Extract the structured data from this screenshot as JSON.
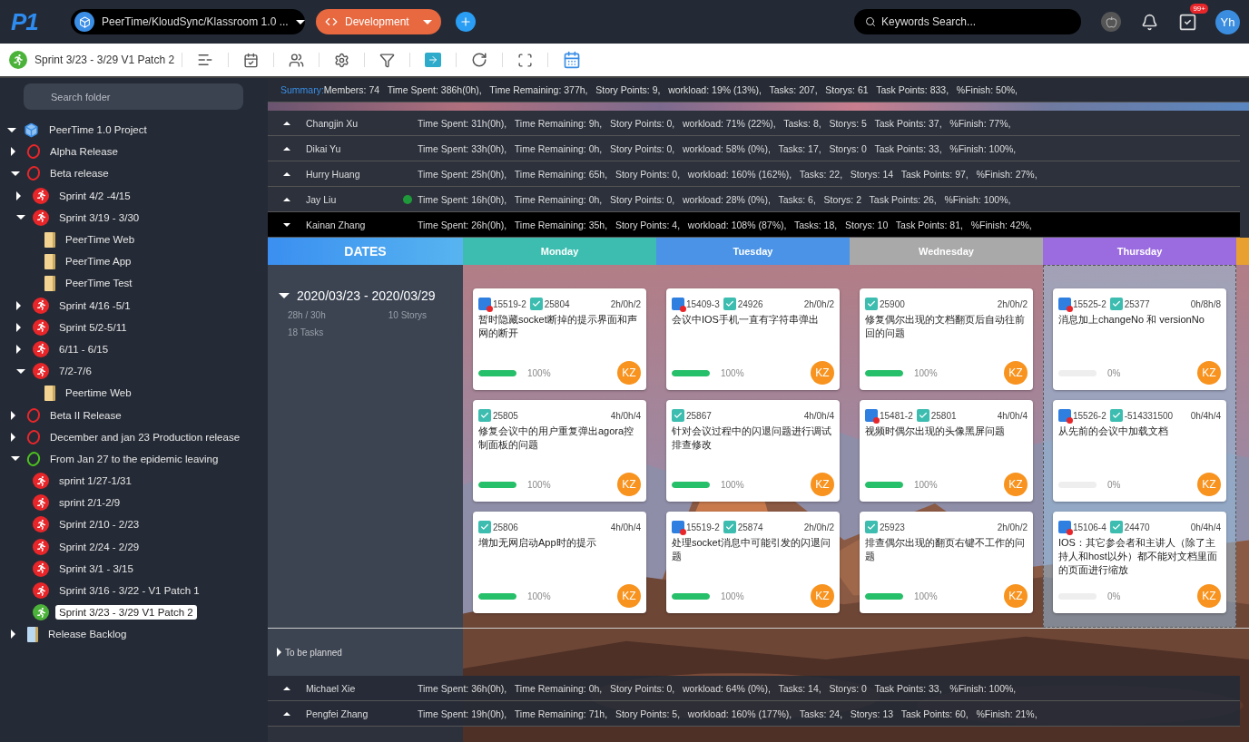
{
  "top_bar": {
    "logo": "P1",
    "project": "PeerTime/KloudSync/Klassroom 1.0 ...",
    "environment": "Development",
    "search": {
      "placeholder": "Keywords Search..."
    },
    "notification_badge": "99+",
    "avatar": "Yh"
  },
  "toolbar": {
    "sprint": "Sprint 3/23 - 3/29 V1 Patch 2"
  },
  "sidebar": {
    "search": {
      "placeholder": "Search folder"
    },
    "tree": [
      {
        "label": "PeerTime 1.0 Project",
        "kind": "project",
        "expanded": true,
        "selected": false,
        "children": [
          {
            "label": "Alpha Release",
            "kind": "release",
            "color": "#e8262a",
            "expanded": false,
            "selected": false
          },
          {
            "label": "Beta release",
            "kind": "release",
            "color": "#e8262a",
            "expanded": true,
            "selected": false,
            "children": [
              {
                "label": "Sprint 4/2 -4/15",
                "kind": "sprint",
                "color": "#e8262a",
                "expanded": false,
                "selected": false
              },
              {
                "label": "Sprint 3/19 - 3/30",
                "kind": "sprint",
                "color": "#e8262a",
                "expanded": true,
                "selected": false,
                "children": [
                  {
                    "label": "PeerTime Web",
                    "kind": "folder",
                    "selected": false
                  },
                  {
                    "label": "PeerTime App",
                    "kind": "folder",
                    "selected": false
                  },
                  {
                    "label": "PeerTime Test",
                    "kind": "folder",
                    "selected": false
                  }
                ]
              },
              {
                "label": "Sprint 4/16 -5/1",
                "kind": "sprint",
                "color": "#e8262a",
                "expanded": false,
                "selected": false
              },
              {
                "label": "Sprint 5/2-5/11",
                "kind": "sprint",
                "color": "#e8262a",
                "expanded": false,
                "selected": false
              },
              {
                "label": "6/11 - 6/15",
                "kind": "sprint",
                "color": "#e8262a",
                "expanded": false,
                "selected": false
              },
              {
                "label": "7/2-7/6",
                "kind": "sprint",
                "color": "#e8262a",
                "expanded": true,
                "selected": false,
                "children": [
                  {
                    "label": "Peertime Web",
                    "kind": "folder",
                    "selected": false
                  }
                ]
              }
            ]
          },
          {
            "label": "Beta II Release",
            "kind": "release",
            "color": "#e8262a",
            "expanded": false,
            "selected": false
          },
          {
            "label": "December and jan 23 Production release",
            "kind": "release",
            "color": "#e8262a",
            "expanded": false,
            "selected": false
          },
          {
            "label": "From Jan 27 to the epidemic leaving",
            "kind": "release",
            "color": "#4cc21e",
            "expanded": true,
            "selected": false,
            "children": [
              {
                "label": "sprint 1/27-1/31",
                "kind": "sprint",
                "color": "#e8262a",
                "selected": false
              },
              {
                "label": "sprint 2/1-2/9",
                "kind": "sprint",
                "color": "#e8262a",
                "selected": false
              },
              {
                "label": "Sprint 2/10 - 2/23",
                "kind": "sprint",
                "color": "#e8262a",
                "selected": false
              },
              {
                "label": "Sprint 2/24 - 2/29",
                "kind": "sprint",
                "color": "#e8262a",
                "selected": false
              },
              {
                "label": "Sprint 3/1 - 3/15",
                "kind": "sprint",
                "color": "#e8262a",
                "selected": false
              },
              {
                "label": "Sprint 3/16 - 3/22 - V1 Patch 1",
                "kind": "sprint",
                "color": "#e8262a",
                "selected": false
              },
              {
                "label": "Sprint 3/23 - 3/29 V1 Patch 2",
                "kind": "sprint",
                "color": "#4cb33a",
                "selected": true
              }
            ]
          },
          {
            "label": "Release Backlog",
            "kind": "backlog",
            "expanded": false,
            "selected": false
          }
        ]
      }
    ]
  },
  "summary": {
    "label": "Summary:",
    "text": "Members: 74   Time Spent: 386h(0h),   Time Remaining: 377h,   Story Points: 9,   workload: 19% (13%),   Tasks: 207,   Storys: 61   Task Points: 833,   %Finish: 50%,"
  },
  "members": [
    {
      "name": "Changjin Xu",
      "online": false,
      "expanded": false,
      "stats": "Time Spent: 31h(0h),   Time Remaining: 9h,   Story Points: 0,   workload: 71% (22%),   Tasks: 8,   Storys: 5   Task Points: 37,   %Finish: 77%,"
    },
    {
      "name": "Dikai Yu",
      "online": false,
      "expanded": false,
      "stats": "Time Spent: 33h(0h),   Time Remaining: 0h,   Story Points: 0,   workload: 58% (0%),   Tasks: 17,   Storys: 0   Task Points: 33,   %Finish: 100%,"
    },
    {
      "name": "Hurry Huang",
      "online": false,
      "expanded": false,
      "stats": "Time Spent: 25h(0h),   Time Remaining: 65h,   Story Points: 0,   workload: 160% (162%),   Tasks: 22,   Storys: 14   Task Points: 97,   %Finish: 27%,"
    },
    {
      "name": "Jay Liu",
      "online": true,
      "expanded": false,
      "stats": "Time Spent: 16h(0h),   Time Remaining: 0h,   Story Points: 0,   workload: 28% (0%),   Tasks: 6,   Storys: 2   Task Points: 26,   %Finish: 100%,"
    },
    {
      "name": "Kainan Zhang",
      "online": false,
      "expanded": true,
      "stats": "Time Spent: 26h(0h),   Time Remaining: 35h,   Story Points: 4,   workload: 108% (87%),   Tasks: 18,   Storys: 10   Task Points: 81,   %Finish: 42%,"
    }
  ],
  "calendar": {
    "dates_header": "DATES",
    "range": {
      "label": "2020/03/23 - 2020/03/29",
      "expanded": true,
      "hours": "28h / 30h",
      "storys": "10 Storys",
      "tasks": "18  Tasks"
    },
    "days": [
      {
        "label": "Monday",
        "color": "#3dbdb0",
        "selected": false,
        "cards": [
          {
            "story": "15519-2",
            "task": "25804",
            "time": "2h/0h/2",
            "title": "暂时隐藏socket断掉的提示界面和声网的断开",
            "level": 1,
            "percent": "100%",
            "assignee": "KZ"
          },
          {
            "task": "25805",
            "time": "4h/0h/4",
            "title": "修复会议中的用户重复弹出agora控制面板的问题",
            "level": 1,
            "percent": "100%",
            "assignee": "KZ"
          },
          {
            "task": "25806",
            "time": "4h/0h/4",
            "title": "增加无网启动App时的提示",
            "level": 1,
            "percent": "100%",
            "assignee": "KZ"
          }
        ]
      },
      {
        "label": "Tuesday",
        "color": "#4a93e6",
        "selected": false,
        "cards": [
          {
            "story": "15409-3",
            "task": "24926",
            "time": "2h/0h/2",
            "title": "会议中IOS手机一直有字符串弹出",
            "level": 1,
            "percent": "100%",
            "assignee": "KZ"
          },
          {
            "task": "25867",
            "time": "4h/0h/4",
            "title": "针对会议过程中的闪退问题进行调试排查修改",
            "level": 1,
            "percent": "100%",
            "assignee": "KZ"
          },
          {
            "story": "15519-2",
            "task": "25874",
            "time": "2h/0h/2",
            "title": "处理socket消息中可能引发的闪退问题",
            "level": 1,
            "percent": "100%",
            "assignee": "KZ"
          }
        ]
      },
      {
        "label": "Wednesday",
        "color": "#a9a9a9",
        "selected": false,
        "cards": [
          {
            "task": "25900",
            "time": "2h/0h/2",
            "title": "修复偶尔出现的文档翻页后自动往前回的问题",
            "level": 1,
            "percent": "100%",
            "assignee": "KZ"
          },
          {
            "story": "15481-2",
            "task": "25801",
            "time": "4h/0h/4",
            "title": "视频时偶尔出现的头像黑屏问题",
            "level": 1,
            "percent": "100%",
            "assignee": "KZ"
          },
          {
            "task": "25923",
            "time": "2h/0h/2",
            "title": "排查偶尔出现的翻页右键不工作的问题",
            "level": 1,
            "percent": "100%",
            "assignee": "KZ"
          }
        ]
      },
      {
        "label": "Thursday",
        "color": "#9b6be0",
        "selected": true,
        "cards": [
          {
            "story": "15525-2",
            "task": "25377",
            "time": "0h/8h/8",
            "title": "消息加上changeNo 和 versionNo",
            "level": 0,
            "percent": "0%",
            "assignee": "KZ"
          },
          {
            "story": "15526-2",
            "task": "-514331500",
            "time": "0h/4h/4",
            "title": "从先前的会议中加载文档",
            "level": 0,
            "percent": "0%",
            "assignee": "KZ"
          },
          {
            "story": "15106-4",
            "task": "24470",
            "time": "0h/4h/4",
            "title": "IOS：其它参会者和主讲人（除了主持人和host以外）都不能对文档里面的页面进行缩放",
            "level": 0,
            "percent": "0%",
            "assignee": "KZ"
          }
        ]
      }
    ],
    "to_be_planned": "To be planned"
  },
  "members_below": [
    {
      "name": "Michael Xie",
      "online": false,
      "expanded": false,
      "stats": "Time Spent: 36h(0h),   Time Remaining: 0h,   Story Points: 0,   workload: 64% (0%),   Tasks: 14,   Storys: 0   Task Points: 33,   %Finish: 100%,"
    },
    {
      "name": "Pengfei Zhang",
      "online": false,
      "expanded": false,
      "stats": "Time Spent: 19h(0h),   Time Remaining: 71h,   Story Points: 5,   workload: 160% (177%),   Tasks: 24,   Storys: 13   Task Points: 60,   %Finish: 21%,"
    }
  ]
}
